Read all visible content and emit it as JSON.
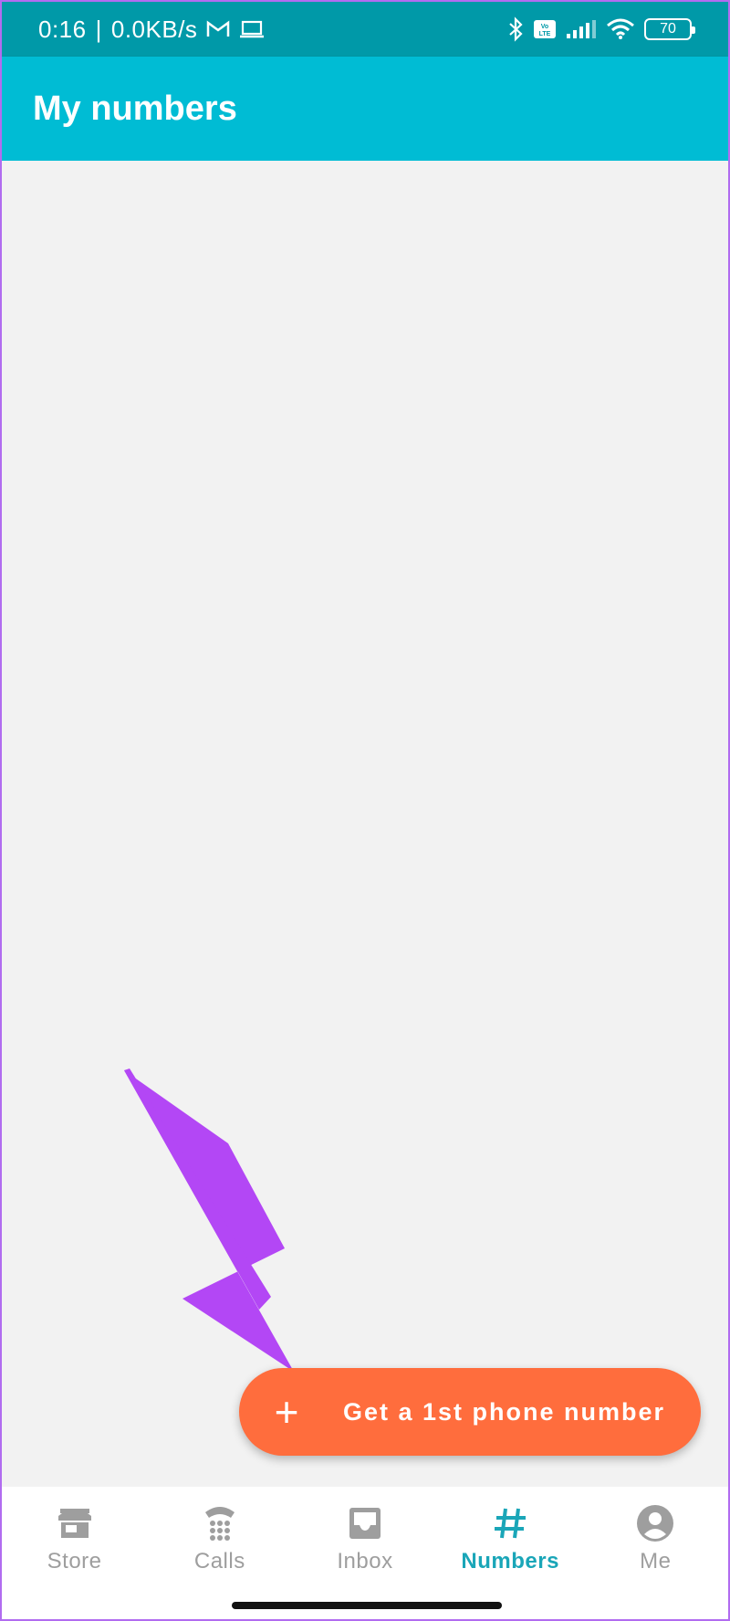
{
  "status_bar": {
    "time": "0:16",
    "speed": "0.0KB/s",
    "battery": "70"
  },
  "app_bar": {
    "title": "My numbers"
  },
  "fab": {
    "icon": "plus-icon",
    "label": "Get a 1st phone number"
  },
  "bottom_nav": {
    "items": [
      {
        "label": "Store",
        "icon": "store-icon"
      },
      {
        "label": "Calls",
        "icon": "dialpad-icon"
      },
      {
        "label": "Inbox",
        "icon": "inbox-icon"
      },
      {
        "label": "Numbers",
        "icon": "hash-icon",
        "active": true
      },
      {
        "label": "Me",
        "icon": "account-icon"
      }
    ]
  },
  "colors": {
    "status_bar": "#0099a8",
    "app_bar": "#00bcd4",
    "fab": "#ff6d3d",
    "active_nav": "#1aa6b8",
    "annotation_arrow": "#b347f5"
  }
}
